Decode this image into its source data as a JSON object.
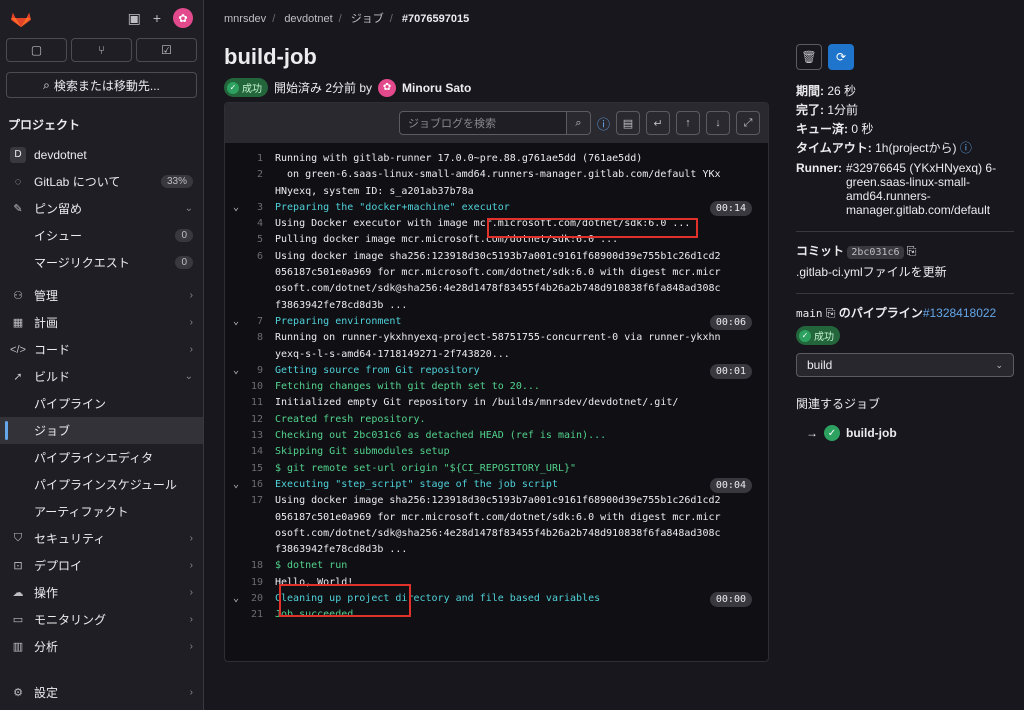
{
  "sidebar": {
    "search_label": "検索または移動先...",
    "section_title": "プロジェクト",
    "project_name": "devdotnet",
    "project_initial": "D",
    "items": [
      {
        "label": "GitLab について",
        "badge": "33%"
      },
      {
        "label": "ピン留め"
      },
      {
        "label": "イシュー",
        "badge": "0"
      },
      {
        "label": "マージリクエスト",
        "badge": "0"
      },
      {
        "label": "管理"
      },
      {
        "label": "計画"
      },
      {
        "label": "コード"
      },
      {
        "label": "ビルド"
      },
      {
        "label": "パイプライン"
      },
      {
        "label": "ジョブ"
      },
      {
        "label": "パイプラインエディタ"
      },
      {
        "label": "パイプラインスケジュール"
      },
      {
        "label": "アーティファクト"
      },
      {
        "label": "セキュリティ"
      },
      {
        "label": "デプロイ"
      },
      {
        "label": "操作"
      },
      {
        "label": "モニタリング"
      },
      {
        "label": "分析"
      },
      {
        "label": "設定"
      }
    ]
  },
  "breadcrumb": [
    "mnrsdev",
    "devdotnet",
    "ジョブ",
    "#7076597015"
  ],
  "job": {
    "title": "build-job",
    "status": "成功",
    "started": "開始済み 2分前 by",
    "user": "Minoru Sato"
  },
  "log": {
    "search_placeholder": "ジョブログを検索",
    "lines": [
      {
        "n": "1",
        "t": "Running with gitlab-runner 17.0.0~pre.88.g761ae5dd (761ae5dd)",
        "c": ""
      },
      {
        "n": "2",
        "t": "  on green-6.saas-linux-small-amd64.runners-manager.gitlab.com/default YKx",
        "c": ""
      },
      {
        "n": "",
        "t": "HNyexq, system ID: s_a201ab37b78a",
        "c": ""
      },
      {
        "n": "3",
        "t": "Preparing the \"docker+machine\" executor",
        "c": "cyan",
        "fold": true,
        "dur": "00:14"
      },
      {
        "n": "4",
        "t": "Using Docker executor with image mcr.microsoft.com/dotnet/sdk:6.0 ...",
        "c": ""
      },
      {
        "n": "5",
        "t": "Pulling docker image mcr.microsoft.com/dotnet/sdk:6.0 ...",
        "c": ""
      },
      {
        "n": "6",
        "t": "Using docker image sha256:123918d30c5193b7a001c9161f68900d39e755b1c26d1cd2",
        "c": ""
      },
      {
        "n": "",
        "t": "056187c501e0a969 for mcr.microsoft.com/dotnet/sdk:6.0 with digest mcr.micr",
        "c": ""
      },
      {
        "n": "",
        "t": "osoft.com/dotnet/sdk@sha256:4e28d1478f83455f4b26a2b748d910838f6fa848ad308c",
        "c": ""
      },
      {
        "n": "",
        "t": "f3863942fe78cd8d3b ...",
        "c": ""
      },
      {
        "n": "7",
        "t": "Preparing environment",
        "c": "cyan",
        "fold": true,
        "dur": "00:06"
      },
      {
        "n": "8",
        "t": "Running on runner-ykxhnyexq-project-58751755-concurrent-0 via runner-ykxhn",
        "c": ""
      },
      {
        "n": "",
        "t": "yexq-s-l-s-amd64-1718149271-2f743820...",
        "c": ""
      },
      {
        "n": "9",
        "t": "Getting source from Git repository",
        "c": "cyan",
        "fold": true,
        "dur": "00:01"
      },
      {
        "n": "10",
        "t": "Fetching changes with git depth set to 20...",
        "c": "green"
      },
      {
        "n": "11",
        "t": "Initialized empty Git repository in /builds/mnrsdev/devdotnet/.git/",
        "c": ""
      },
      {
        "n": "12",
        "t": "Created fresh repository.",
        "c": "green"
      },
      {
        "n": "13",
        "t": "Checking out 2bc031c6 as detached HEAD (ref is main)...",
        "c": "green"
      },
      {
        "n": "14",
        "t": "Skipping Git submodules setup",
        "c": "green"
      },
      {
        "n": "15",
        "t": "$ git remote set-url origin \"${CI_REPOSITORY_URL}\"",
        "c": "green"
      },
      {
        "n": "16",
        "t": "Executing \"step_script\" stage of the job script",
        "c": "cyan",
        "fold": true,
        "dur": "00:04"
      },
      {
        "n": "17",
        "t": "Using docker image sha256:123918d30c5193b7a001c9161f68900d39e755b1c26d1cd2",
        "c": ""
      },
      {
        "n": "",
        "t": "056187c501e0a969 for mcr.microsoft.com/dotnet/sdk:6.0 with digest mcr.micr",
        "c": ""
      },
      {
        "n": "",
        "t": "osoft.com/dotnet/sdk@sha256:4e28d1478f83455f4b26a2b748d910838f6fa848ad308c",
        "c": ""
      },
      {
        "n": "",
        "t": "f3863942fe78cd8d3b ...",
        "c": ""
      },
      {
        "n": "18",
        "t": "$ dotnet run",
        "c": "green"
      },
      {
        "n": "19",
        "t": "Hello, World!",
        "c": ""
      },
      {
        "n": "20",
        "t": "Cleaning up project directory and file based variables",
        "c": "cyan",
        "fold": true,
        "dur": "00:00"
      },
      {
        "n": "21",
        "t": "Job succeeded",
        "c": "green"
      }
    ]
  },
  "details": {
    "duration_label": "期間:",
    "duration": "26 秒",
    "finished_label": "完了:",
    "finished": "1分前",
    "queued_label": "キュー済:",
    "queued": "0 秒",
    "timeout_label": "タイムアウト:",
    "timeout": "1h(projectから)",
    "runner_label": "Runner:",
    "runner": "#32976645 (YKxHNyexq) 6-green.saas-linux-small-amd64.runners-manager.gitlab.com/default",
    "commit_label": "コミット",
    "commit_sha": "2bc031c6",
    "commit_message": ".gitlab-ci.ymlファイルを更新",
    "branch": "main",
    "pipeline_label": "のパイプライン",
    "pipeline_id": "#1328418022",
    "pipeline_status": "成功",
    "stage_select": "build",
    "related_jobs_label": "関連するジョブ",
    "related_job": "build-job"
  },
  "colors": {
    "accent": "#1f75cb",
    "success": "#2da160",
    "highlight": "#e0312b"
  }
}
